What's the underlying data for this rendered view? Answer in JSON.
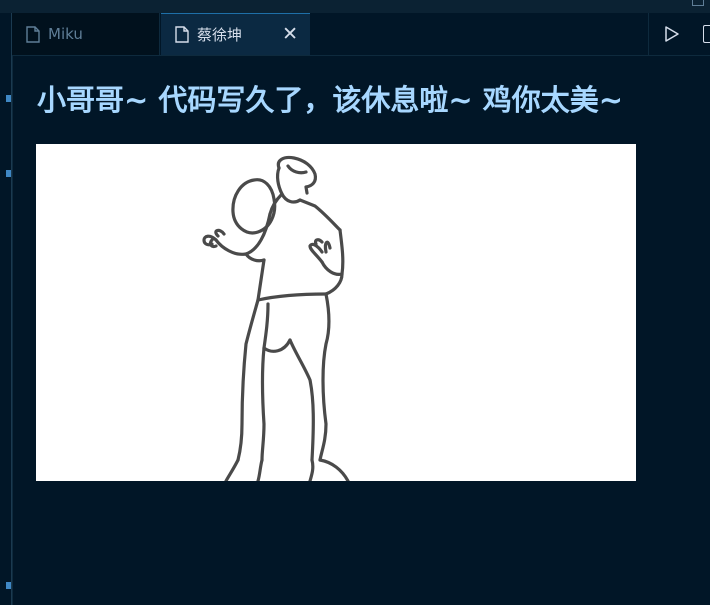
{
  "tabs": [
    {
      "label": "Miku",
      "active": false
    },
    {
      "label": "蔡徐坤",
      "active": true,
      "close_glyph": "✕"
    }
  ],
  "actions": {
    "run_icon": "play-icon",
    "split_icon": "split-editor-icon"
  },
  "content": {
    "heading": "小哥哥~ 代码写久了，该休息啦~ 鸡你太美~",
    "image_alt": "line drawing of a person dribbling a basketball"
  },
  "colors": {
    "background": "#011627",
    "heading": "#a7d7ff",
    "active_tab": "#0b2942",
    "inactive_tab": "#01111d"
  }
}
